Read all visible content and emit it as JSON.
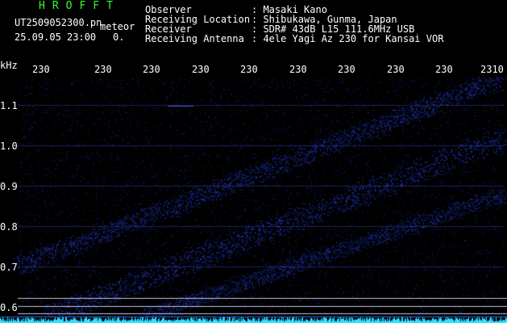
{
  "header": {
    "title": "HROFFT",
    "filename": "UT2509052300.pn",
    "mode": "meteor",
    "timestamp": "25.09.05 23:00",
    "counter": "0.",
    "fields": [
      {
        "label": "Observer",
        "value": ": Masaki Kano"
      },
      {
        "label": "Receiving Location",
        "value": ": Shibukawa, Gunma, Japan"
      },
      {
        "label": "Receiver",
        "value": ": SDR# 43dB L15 111.6MHz USB"
      },
      {
        "label": "Receiving Antenna",
        "value": ": 4ele Yagi Az 230 for Kansai VOR"
      }
    ]
  },
  "axis": {
    "unit": "kHz",
    "x_ticks": [
      "230",
      "230",
      "230",
      "230",
      "230",
      "230",
      "230",
      "230",
      "230",
      "2310"
    ],
    "y_ticks": [
      "1.1",
      "1.0",
      "0.9",
      "0.8",
      "0.7",
      "0.6"
    ]
  },
  "colors": {
    "background": "#000000",
    "noise": "#1a2cff",
    "header_green": "#33ff33",
    "baseline": "#2fe0ff"
  }
}
